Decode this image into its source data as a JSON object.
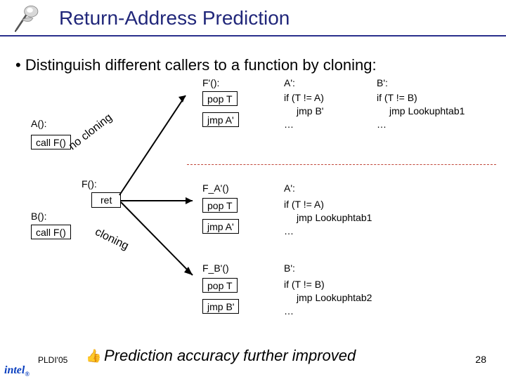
{
  "title": "Return-Address Prediction",
  "bullet": "• Distinguish different callers to a function by cloning:",
  "left": {
    "A": "A():",
    "B": "B():",
    "callF1": "call F()",
    "callF2": "call F()",
    "F": "F():",
    "ret": "ret",
    "no_cloning": "no cloning",
    "cloning": "cloning"
  },
  "top": {
    "Fprime_hdr": "F'():",
    "popT": "pop T",
    "jmpAprime": "jmp A'",
    "Alabel": "A':",
    "A_line1": "if (T != A)",
    "A_line2": "jmp B'",
    "A_line3": "…",
    "Blabel": "B':",
    "B_line1": "if (T != B)",
    "B_line2": "jmp Lookuphtab1",
    "B_line3": "…"
  },
  "bottom": {
    "FA_hdr": "F_A'()",
    "FA_popT": "pop T",
    "FA_jmp": "jmp A'",
    "FA_lbl": "A':",
    "FA_line1": "if (T != A)",
    "FA_line2": "jmp Lookuphtab1",
    "FA_line3": "…",
    "FB_hdr": "F_B'()",
    "FB_popT": "pop T",
    "FB_jmp": "jmp B'",
    "FB_lbl": "B':",
    "FB_line1": "if (T != B)",
    "FB_line2": "jmp Lookuphtab2",
    "FB_line3": "…"
  },
  "conclusion": "Prediction accuracy further improved",
  "footer_left": "PLDI'05",
  "page_number": "28",
  "logo": "intel"
}
